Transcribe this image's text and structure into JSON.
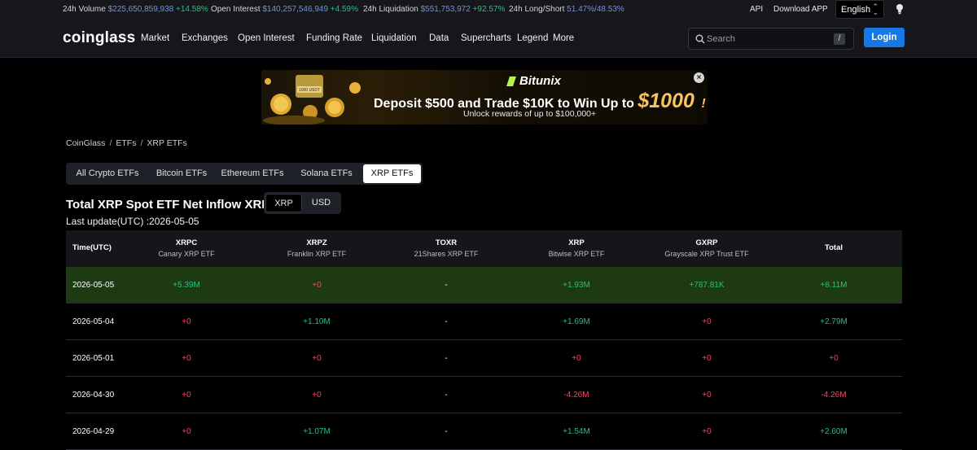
{
  "ticker": {
    "volume_label": "24h Volume",
    "volume_value": "$225,650,859,938",
    "volume_change": "+14.58%",
    "oi_label": "Open Interest",
    "oi_value": "$140,257,546,949",
    "oi_change": "+4.59%",
    "liq_label": "24h Liquidation",
    "liq_value": "$551,753,972",
    "liq_change": "+92.57%",
    "ls_label": "24h Long/Short",
    "ls_value": "51.47%/48.53%",
    "api_label": "API",
    "download_label": "Download APP",
    "language": "English"
  },
  "nav": {
    "logo": "coinglass",
    "items": [
      "Market",
      "Exchanges",
      "Open Interest",
      "Funding Rate",
      "Liquidation",
      "Data",
      "Supercharts",
      "Legend",
      "More"
    ],
    "search_placeholder": "Search",
    "search_shortcut": "/",
    "login_label": "Login"
  },
  "banner": {
    "brand": "Bitunix",
    "headline": "Deposit $500 and Trade $10K to Win Up to",
    "amount": "$1000",
    "exclaim": "!",
    "sub": "Unlock rewards of up to $100,000+",
    "coin_label": "1000 USDT",
    "close": "×"
  },
  "breadcrumb": [
    "CoinGlass",
    "ETFs",
    "XRP ETFs"
  ],
  "tabs": [
    "All Crypto ETFs",
    "Bitcoin ETFs",
    "Ethereum ETFs",
    "Solana ETFs",
    "XRP ETFs"
  ],
  "active_tab": "XRP ETFs",
  "title": "Total XRP Spot ETF Net Inflow XRP",
  "unit_toggle": [
    "XRP",
    "USD"
  ],
  "last_update": "Last update(UTC) :2026-05-05",
  "table": {
    "time_header": "Time(UTC)",
    "total_header": "Total",
    "columns": [
      {
        "code": "XRPC",
        "name": "Canary XRP ETF"
      },
      {
        "code": "XRPZ",
        "name": "Franklin XRP ETF"
      },
      {
        "code": "TOXR",
        "name": "21Shares XRP ETF"
      },
      {
        "code": "XRP",
        "name": "Bitwise XRP ETF"
      },
      {
        "code": "GXRP",
        "name": "Grayscale XRP Trust ETF"
      }
    ],
    "rows": [
      {
        "date": "2026-05-05",
        "values": [
          "+5.39M",
          "+0",
          "-",
          "+1.93M",
          "+787.81K"
        ],
        "total": "+8.11M"
      },
      {
        "date": "2026-05-04",
        "values": [
          "+0",
          "+1.10M",
          "-",
          "+1.69M",
          "+0"
        ],
        "total": "+2.79M"
      },
      {
        "date": "2026-05-01",
        "values": [
          "+0",
          "+0",
          "-",
          "+0",
          "+0"
        ],
        "total": "+0"
      },
      {
        "date": "2026-04-30",
        "values": [
          "+0",
          "+0",
          "-",
          "-4.26M",
          "+0"
        ],
        "total": "-4.26M"
      },
      {
        "date": "2026-04-29",
        "values": [
          "+0",
          "+1.07M",
          "-",
          "+1.54M",
          "+0"
        ],
        "total": "+2.60M"
      }
    ]
  },
  "colors": {
    "positive": "#2ebd85",
    "negative": "#f6465d",
    "highlight_row": "#1d3a13",
    "accent": "#1677e6"
  }
}
